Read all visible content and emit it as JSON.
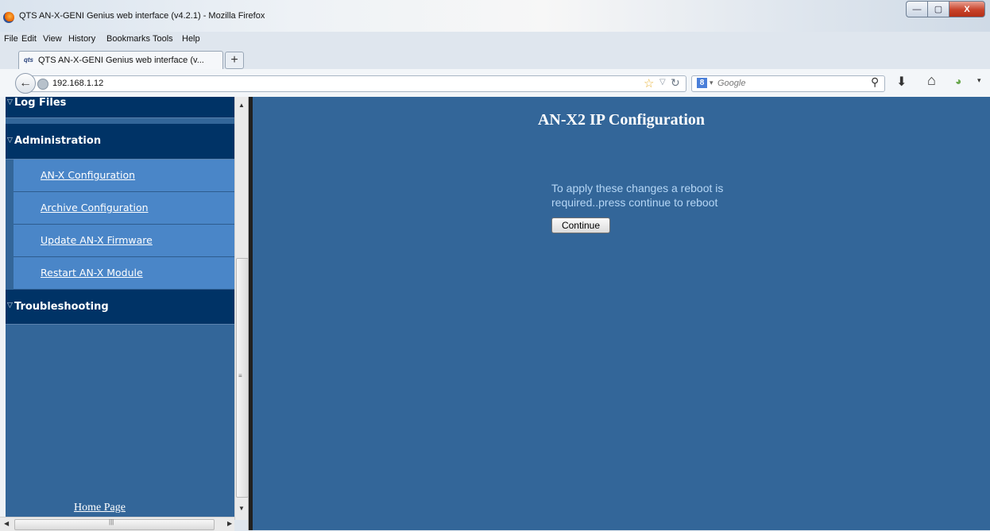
{
  "window": {
    "title": "QTS AN-X-GENI Genius web interface (v4.2.1) - Mozilla Firefox",
    "minimize": "—",
    "maximize": "▢",
    "close": "X"
  },
  "menu": {
    "file": "File",
    "edit": "Edit",
    "view": "View",
    "history": "History",
    "bookmarks": "Bookmarks",
    "tools": "Tools",
    "help": "Help"
  },
  "tab": {
    "favicon": "qts",
    "label": "QTS AN-X-GENI Genius web interface (v...",
    "new_tab": "+"
  },
  "navbar": {
    "url": "192.168.1.12",
    "search_placeholder": "Google",
    "search_engine_icon": "8"
  },
  "sidebar": {
    "sections": {
      "log_files": "Log Files",
      "administration": "Administration",
      "troubleshooting": "Troubleshooting"
    },
    "items": [
      {
        "label": "AN-X Configuration"
      },
      {
        "label": "Archive Configuration"
      },
      {
        "label": "Update AN-X Firmware"
      },
      {
        "label": "Restart AN-X Module"
      }
    ],
    "home_link": "Home Page"
  },
  "main": {
    "title": "AN-X2 IP Configuration",
    "message": "To apply these changes a reboot is required..press continue to reboot",
    "continue_label": "Continue"
  },
  "colors": {
    "content_bg": "#336699",
    "section_bg": "#003366",
    "item_bg": "#4a86c8",
    "message_text": "#b5d6f5"
  }
}
